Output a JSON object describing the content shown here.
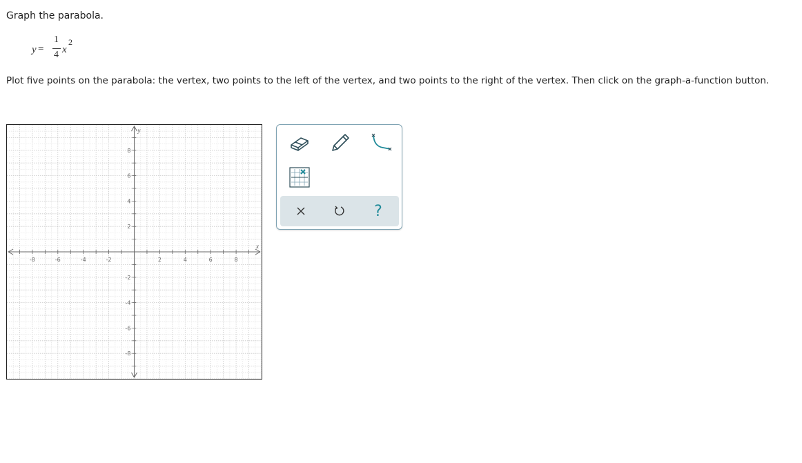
{
  "question": {
    "title": "Graph the parabola.",
    "instructions": "Plot five points on the parabola: the vertex, two points to the left of the vertex, and two points to the right of the vertex. Then click on the graph-a-function button."
  },
  "equation": {
    "lhs": "y",
    "equals": "=",
    "numerator": "1",
    "denominator": "4",
    "variable": "x",
    "exponent": "2"
  },
  "graph": {
    "x_axis_label": "x",
    "y_axis_label": "y",
    "x_ticks": [
      "-8",
      "-6",
      "-4",
      "-2",
      "2",
      "4",
      "6",
      "8"
    ],
    "y_ticks": [
      "8",
      "6",
      "4",
      "2",
      "-2",
      "-4",
      "-6",
      "-8"
    ],
    "x_range": [
      -10,
      10
    ],
    "y_range": [
      -10,
      10
    ],
    "grid": true
  },
  "toolbar": {
    "tools": [
      {
        "name": "eraser-tool",
        "icon": "eraser-icon"
      },
      {
        "name": "pencil-tool",
        "icon": "pencil-icon"
      },
      {
        "name": "graph-a-function-tool",
        "icon": "curve-icon"
      },
      {
        "name": "point-tool",
        "icon": "grid-point-icon"
      }
    ],
    "actions": [
      {
        "name": "clear-all-button",
        "icon": "close-icon"
      },
      {
        "name": "undo-button",
        "icon": "undo-icon"
      },
      {
        "name": "help-button",
        "icon": "help-icon",
        "label": "?"
      }
    ]
  },
  "colors": {
    "accent": "#1f8a99",
    "tool_stroke": "#2f4f5a",
    "action_bar": "#dbe4e8",
    "border": "#7fa3b3"
  }
}
